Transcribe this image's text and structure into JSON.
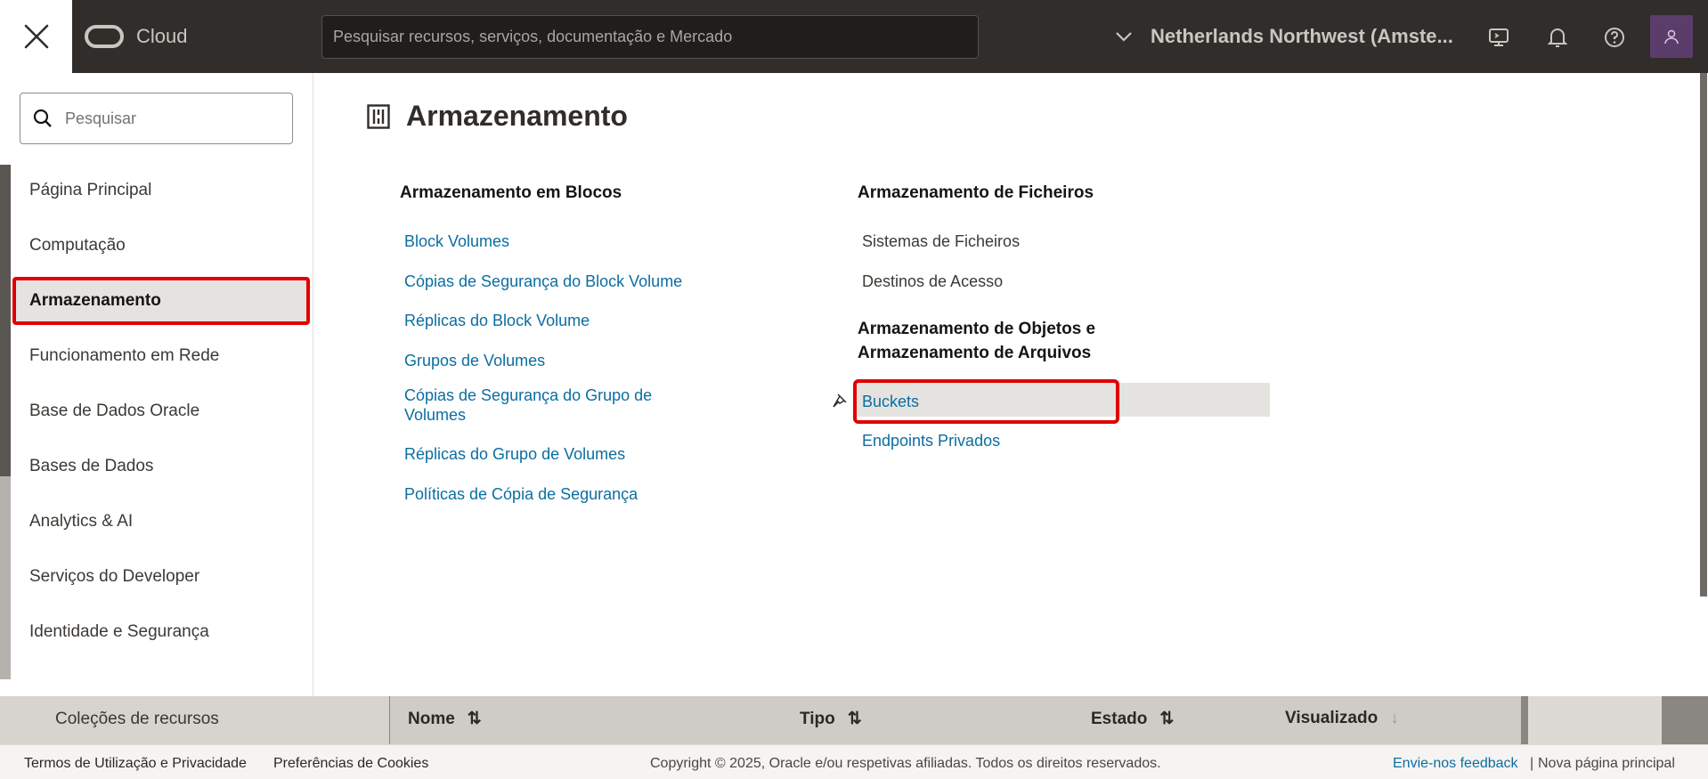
{
  "header": {
    "close_label": "",
    "brand": "Cloud",
    "search_placeholder": "Pesquisar recursos, serviços, documentação e Mercado",
    "region": "Netherlands Northwest (Amste..."
  },
  "menu": {
    "search_placeholder": "Pesquisar",
    "items": [
      {
        "label": "Página Principal"
      },
      {
        "label": "Computação"
      },
      {
        "label": "Armazenamento",
        "selected": true
      },
      {
        "label": "Funcionamento em Rede"
      },
      {
        "label": "Base de Dados Oracle"
      },
      {
        "label": "Bases de Dados"
      },
      {
        "label": "Analytics & AI"
      },
      {
        "label": "Serviços do Developer"
      },
      {
        "label": "Identidade e Segurança"
      }
    ]
  },
  "content": {
    "title": "Armazenamento",
    "block_storage": {
      "heading": "Armazenamento em Blocos",
      "links": [
        "Block Volumes",
        "Cópias de Segurança do Block Volume",
        "Réplicas do Block Volume",
        "Grupos de Volumes",
        "Cópias de Segurança do Grupo de Volumes",
        "Réplicas do Grupo de Volumes",
        "Políticas de Cópia de Segurança"
      ]
    },
    "file_storage": {
      "heading": "Armazenamento de Ficheiros",
      "links": [
        "Sistemas de Ficheiros",
        "Destinos de Acesso"
      ]
    },
    "object_storage": {
      "heading_line1": "Armazenamento de Objetos e",
      "heading_line2": "Armazenamento de Arquivos",
      "links": [
        "Buckets",
        "Endpoints Privados"
      ]
    }
  },
  "background": {
    "left_item": "Coleções de recursos",
    "columns": [
      "Nome",
      "Tipo",
      "Estado",
      "Visualizado"
    ]
  },
  "footer": {
    "terms": "Termos de Utilização e Privacidade",
    "cookies": "Preferências de Cookies",
    "copyright": "Copyright © 2025, Oracle e/ou respetivas afiliadas. Todos os direitos reservados.",
    "feedback": "Envie-nos feedback",
    "separator": "|",
    "new_home": "Nova página principal"
  },
  "colors": {
    "header_bg": "#312d2a",
    "link": "#0b6ea1",
    "highlight": "#e00000"
  }
}
